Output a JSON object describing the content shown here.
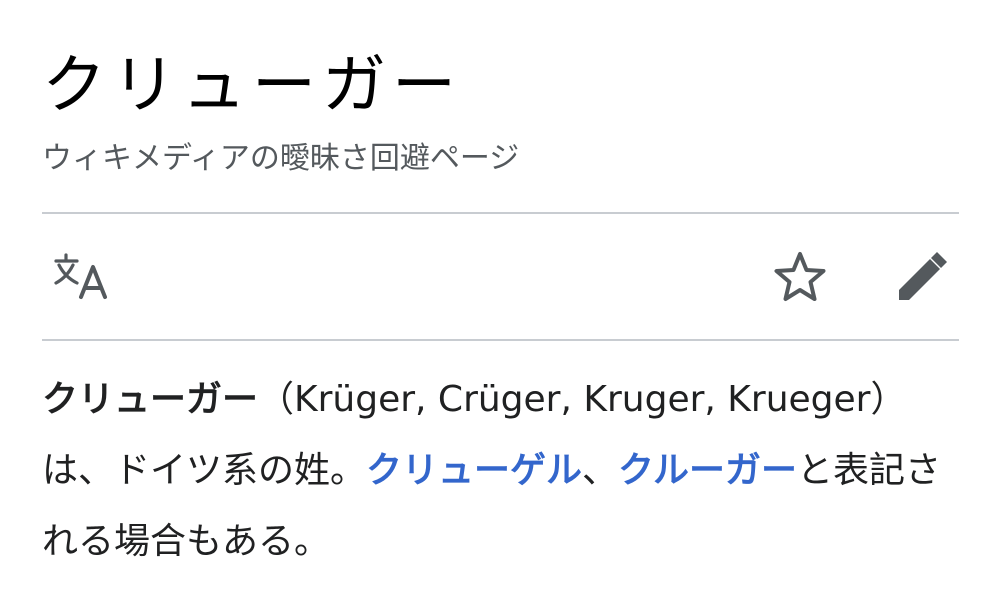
{
  "article": {
    "title": "クリューガー",
    "subtitle": "ウィキメディアの曖昧さ回避ページ"
  },
  "toolbar": {
    "language_icon": "translate-icon",
    "watch_icon": "star-outline-icon",
    "edit_icon": "pencil-icon"
  },
  "body": {
    "lead_bold": "クリューガー",
    "lead_text": "（Krüger, Crüger, Kruger, Krueger）は、ドイツ系の姓。",
    "link1": "クリューゲル",
    "separator": "、",
    "link2": "クルーガー",
    "tail_text": "と表記される場合もある。"
  },
  "colors": {
    "link": "#3366cc",
    "subtitle": "#54595d",
    "divider": "#c8ccd1",
    "icon": "#54595d"
  }
}
